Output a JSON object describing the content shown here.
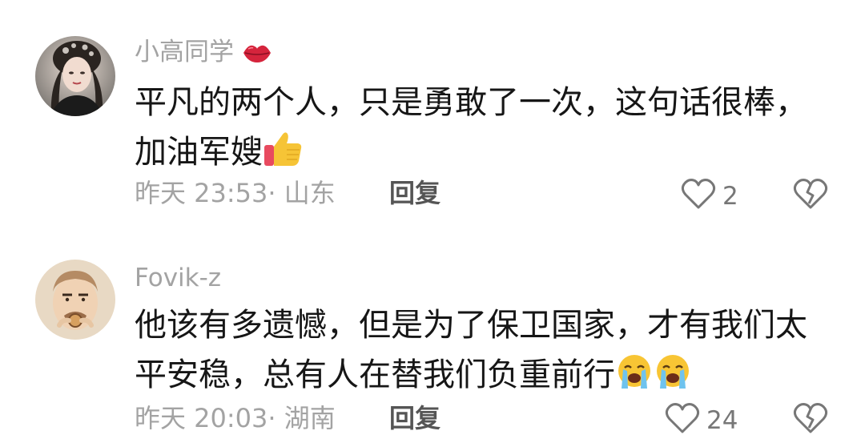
{
  "comments": [
    {
      "username": "小高同学",
      "username_badge_icon": "lips-icon",
      "text": "平凡的两个人，只是勇敢了一次，这句话很棒，加油军嫂",
      "text_emojis": [
        "thumbs-up-icon"
      ],
      "timestamp": "昨天 23:53",
      "location": "山东",
      "reply_label": "回复",
      "like_count": "2"
    },
    {
      "username": "Fovik-z",
      "text": "他该有多遗憾，但是为了保卫国家，才有我们太平安稳，总有人在替我们负重前行",
      "text_emojis": [
        "crying-face-icon",
        "crying-face-icon"
      ],
      "timestamp": "昨天 20:03",
      "location": "湖南",
      "reply_label": "回复",
      "like_count": "24"
    }
  ],
  "colors": {
    "muted_text": "#a3a3a3",
    "body_text": "#161616",
    "reply_text": "#555555",
    "icon": "#777777"
  }
}
